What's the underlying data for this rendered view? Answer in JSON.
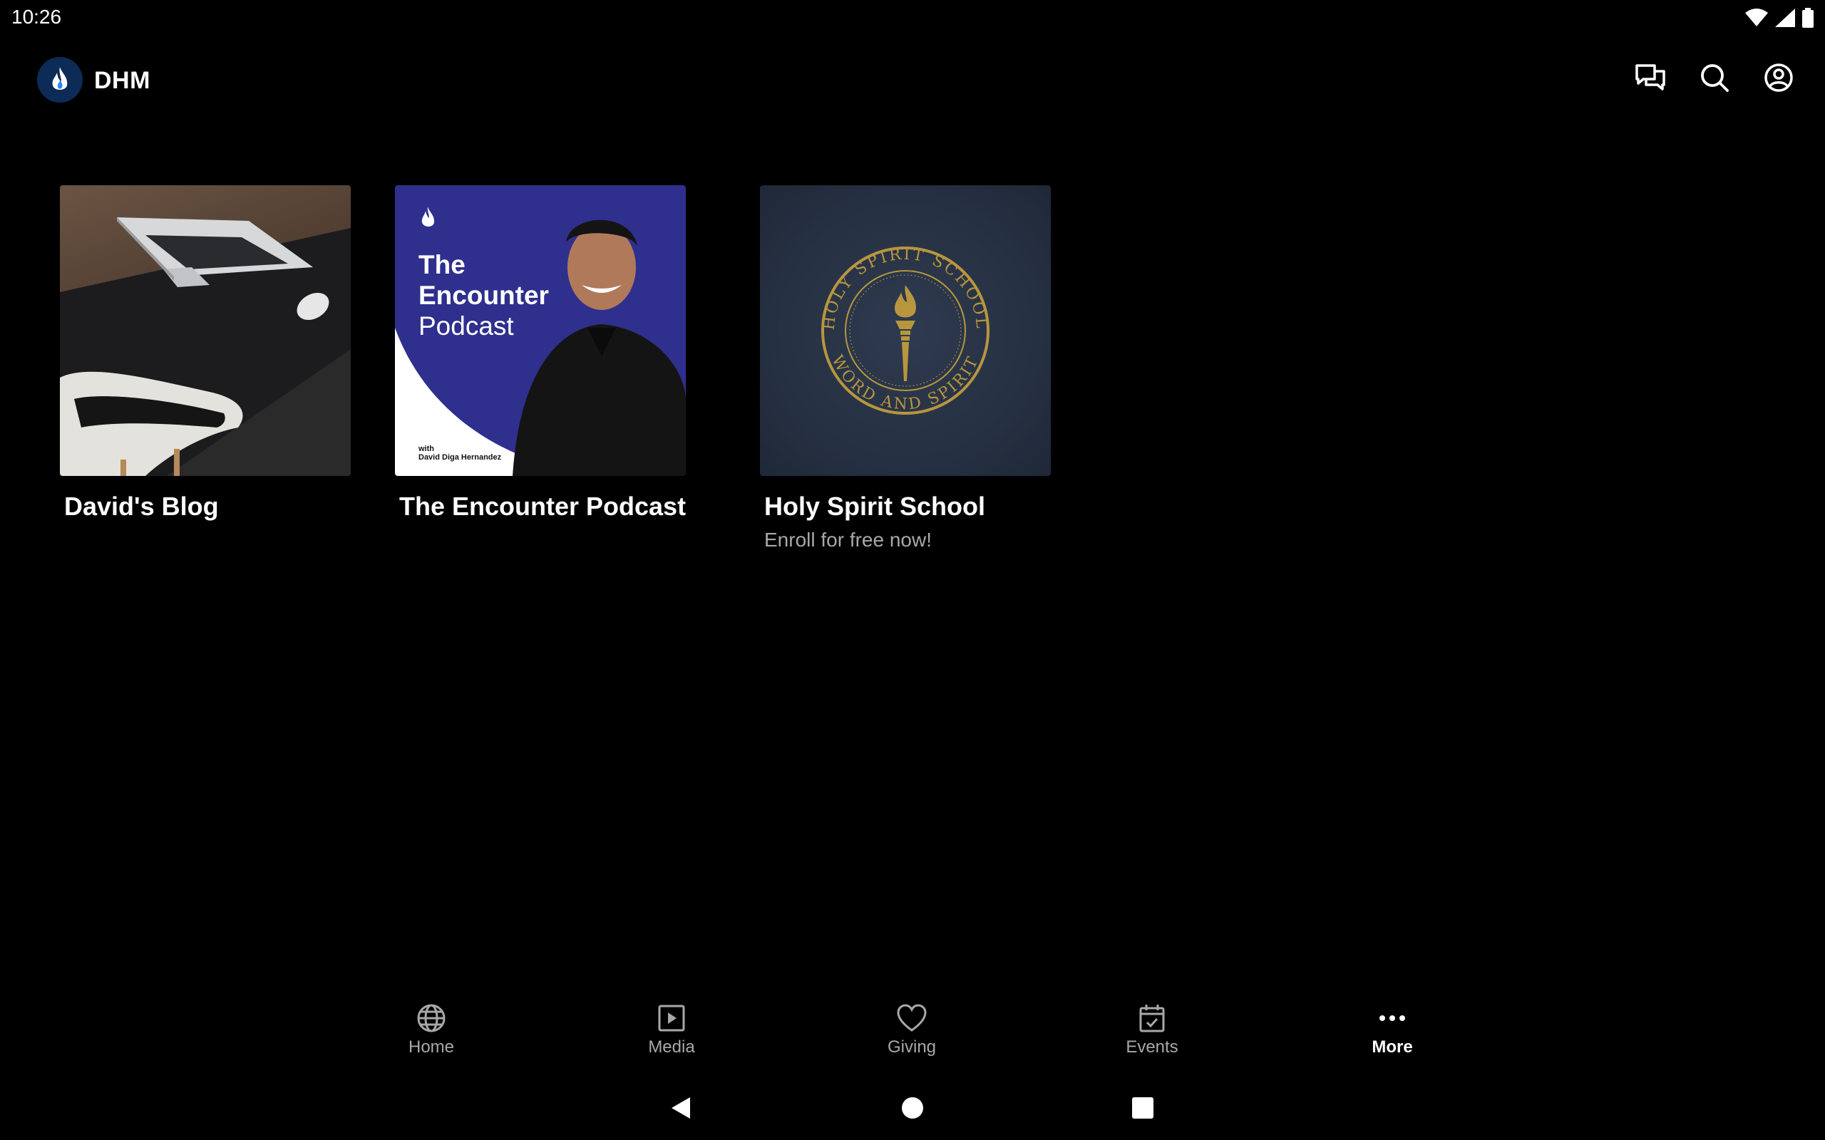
{
  "status_bar": {
    "time": "10:26",
    "icons": [
      "wifi-icon",
      "signal-icon",
      "battery-icon"
    ]
  },
  "app_bar": {
    "title": "DHM",
    "logo": "flame-logo",
    "actions": [
      "chat-icon",
      "search-icon",
      "account-icon"
    ]
  },
  "cards": [
    {
      "title": "David's Blog",
      "subtitle": "",
      "image": "laptop-desk-photo"
    },
    {
      "title": "The Encounter Podcast",
      "subtitle": "",
      "image": "podcast-cover",
      "cover_text": {
        "line1": "The",
        "line2": "Encounter",
        "line3": "Podcast",
        "with": "with",
        "host": "David Diga Hernandez"
      }
    },
    {
      "title": "Holy Spirit School",
      "subtitle": "Enroll for free now!",
      "image": "school-seal",
      "seal_text": {
        "top": "HOLY SPIRIT SCHOOL",
        "bottom": "WORD AND SPIRIT"
      }
    }
  ],
  "bottom_nav": {
    "items": [
      {
        "label": "Home",
        "icon": "globe-icon",
        "active": false
      },
      {
        "label": "Media",
        "icon": "play-icon",
        "active": false
      },
      {
        "label": "Giving",
        "icon": "heart-icon",
        "active": false
      },
      {
        "label": "Events",
        "icon": "calendar-icon",
        "active": false
      },
      {
        "label": "More",
        "icon": "more-dots-icon",
        "active": true
      }
    ]
  },
  "system_nav": [
    "back-button",
    "home-button",
    "recents-button"
  ],
  "colors": {
    "background": "#000000",
    "inactive": "#a8a8a8",
    "active": "#ffffff",
    "podcast_blue": "#2f2f8e",
    "seal_gold": "#b8963e",
    "logo_blue": "#0c2c57"
  }
}
